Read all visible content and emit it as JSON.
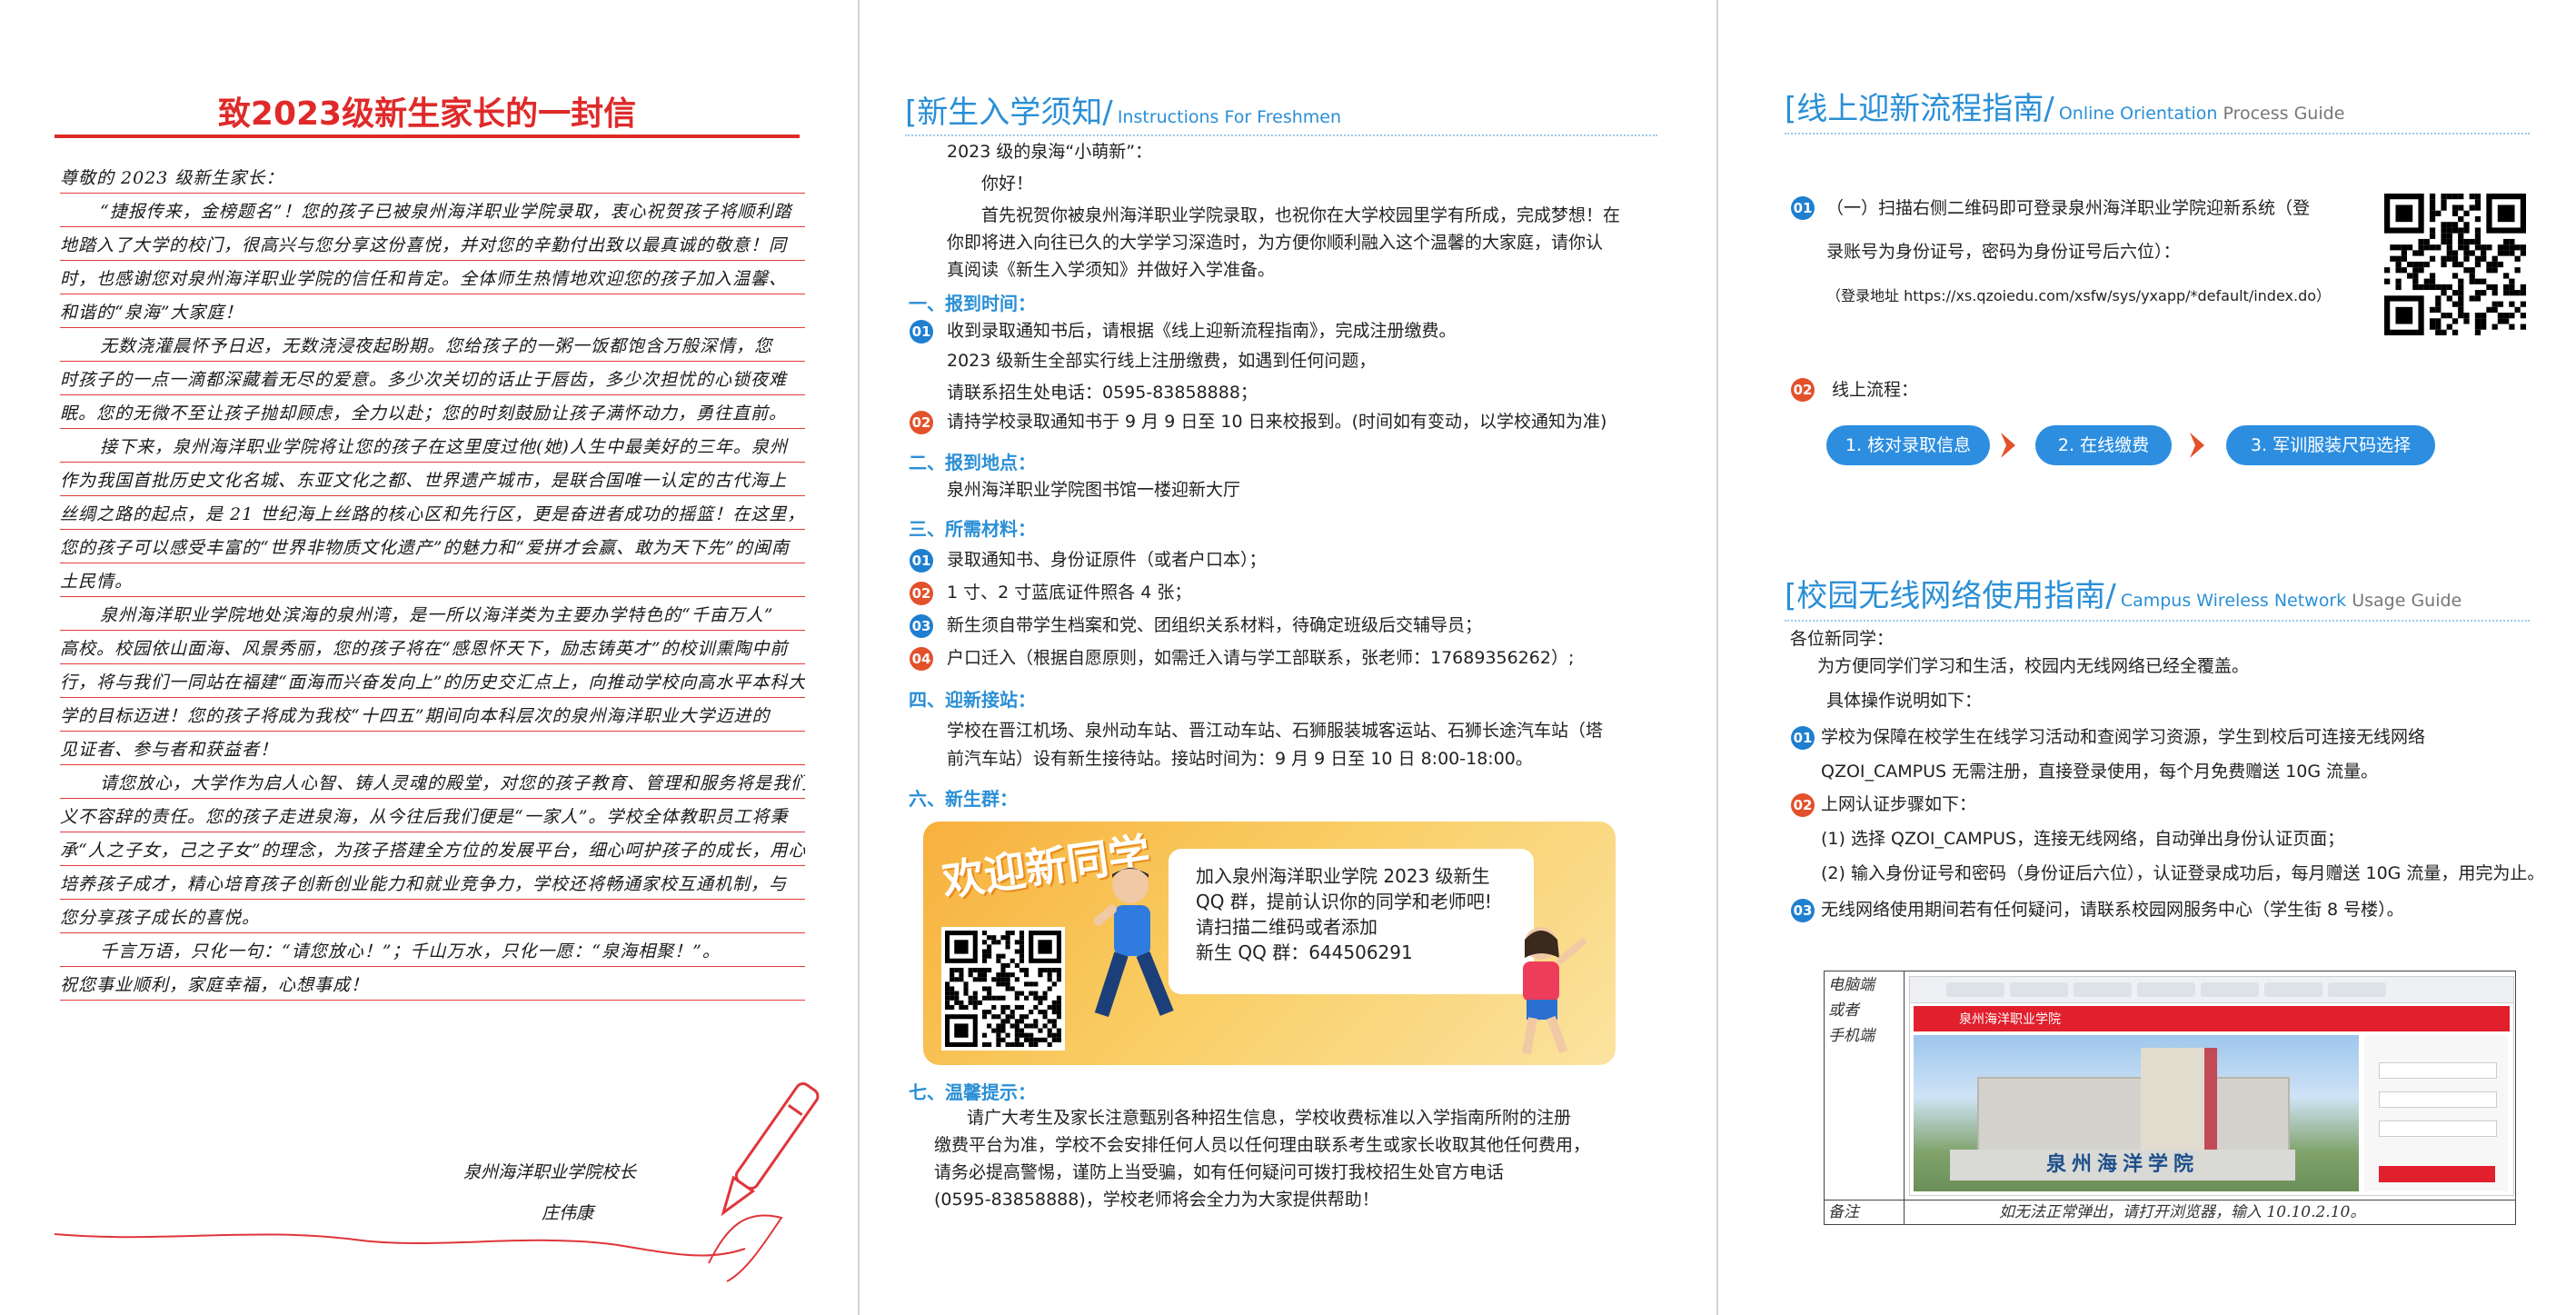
{
  "letter": {
    "title": "致2023级新生家长的一封信",
    "lines": [
      {
        "t": "尊敬的 2023 级新生家长：",
        "indent": false
      },
      {
        "t": "“捷报传来，金榜题名”！您的孩子已被泉州海洋职业学院录取，衷心祝贺孩子将顺利踏",
        "indent": true
      },
      {
        "t": "地踏入了大学的校门，很高兴与您分享这份喜悦，并对您的辛勤付出致以最真诚的敬意！同",
        "indent": false
      },
      {
        "t": "时，也感谢您对泉州海洋职业学院的信任和肯定。全体师生热情地欢迎您的孩子加入温馨、",
        "indent": false
      },
      {
        "t": "和谐的“泉海”大家庭！",
        "indent": false
      },
      {
        "t": "无数浇灌晨怀予日迟，无数浇浸夜起盼期。您给孩子的一粥一饭都饱含万般深情，您",
        "indent": true
      },
      {
        "t": "时孩子的一点一滴都深藏着无尽的爱意。多少次关切的话止于唇齿，多少次担忧的心锁夜难",
        "indent": false
      },
      {
        "t": "眠。您的无微不至让孩子抛却顾虑，全力以赴；您的时刻鼓励让孩子满怀动力，勇往直前。",
        "indent": false
      },
      {
        "t": "接下来，泉州海洋职业学院将让您的孩子在这里度过他(她)人生中最美好的三年。泉州",
        "indent": true
      },
      {
        "t": "作为我国首批历史文化名城、东亚文化之都、世界遗产城市，是联合国唯一认定的古代海上",
        "indent": false
      },
      {
        "t": "丝绸之路的起点，是 21 世纪海上丝路的核心区和先行区，更是奋进者成功的摇篮！在这里，",
        "indent": false
      },
      {
        "t": "您的孩子可以感受丰富的“世界非物质文化遗产”的魅力和“爱拼才会赢、敢为天下先”的闽南",
        "indent": false
      },
      {
        "t": "土民情。",
        "indent": false
      },
      {
        "t": "泉州海洋职业学院地处滨海的泉州湾，是一所以海洋类为主要办学特色的“千亩万人”",
        "indent": true
      },
      {
        "t": "高校。校园依山面海、风景秀丽，您的孩子将在“感恩怀天下，励志铸英才”的校训熏陶中前",
        "indent": false
      },
      {
        "t": "行，将与我们一同站在福建“面海而兴奋发向上”的历史交汇点上，向推动学校向高水平本科大",
        "indent": false
      },
      {
        "t": "学的目标迈进！您的孩子将成为我校“十四五”期间向本科层次的泉州海洋职业大学迈进的",
        "indent": false
      },
      {
        "t": "见证者、参与者和获益者！",
        "indent": false
      },
      {
        "t": "请您放心，大学作为启人心智、铸人灵魂的殿堂，对您的孩子教育、管理和服务将是我们",
        "indent": true
      },
      {
        "t": "义不容辞的责任。您的孩子走进泉海，从今往后我们便是“一家人”。学校全体教职员工将秉",
        "indent": false
      },
      {
        "t": "承“人之子女，己之子女”的理念，为孩子搭建全方位的发展平台，细心呵护孩子的成长，用心",
        "indent": false
      },
      {
        "t": "培养孩子成才，精心培育孩子创新创业能力和就业竞争力，学校还将畅通家校互通机制，与",
        "indent": false
      },
      {
        "t": "您分享孩子成长的喜悦。",
        "indent": false
      },
      {
        "t": "千言万语，只化一句：“请您放心！”；千山万水，只化一愿：“泉海相聚！”。",
        "indent": true
      },
      {
        "t": "祝您事业顺利，家庭幸福，心想事成！",
        "indent": false
      }
    ],
    "signature_school": "泉州海洋职业学院校长",
    "signature_name": "庄伟康"
  },
  "instructions": {
    "title_zh": "[新生入学须知/",
    "title_en": "Instructions For Freshmen",
    "greeting": "2023 级的泉海“小萌新”：",
    "hello": "你好！",
    "intro1": "首先祝贺你被泉州海洋职业学院录取，也祝你在大学校园里学有所成，完成梦想！在",
    "intro2": "你即将进入向往已久的大学学习深造时，为方便你顺利融入这个温馨的大家庭，请你认",
    "intro3": "真阅读《新生入学须知》并做好入学准备。",
    "s1_title": "一、报到时间：",
    "s1_i1": "收到录取通知书后，请根据《线上迎新流程指南》，完成注册缴费。",
    "s1_i1b": "2023 级新生全部实行线上注册缴费，如遇到任何问题，",
    "s1_i1c": "请联系招生处电话：0595-83858888；",
    "s1_i2": "请持学校录取通知书于 9 月 9 日至 10 日来校报到。(时间如有变动，以学校通知为准)",
    "s2_title": "二、报到地点：",
    "s2_text": "泉州海洋职业学院图书馆一楼迎新大厅",
    "s3_title": "三、所需材料：",
    "s3_i1": "录取通知书、身份证原件（或者户口本）；",
    "s3_i2": "1 寸、2 寸蓝底证件照各 4 张；",
    "s3_i3": "新生须自带学生档案和党、团组织关系材料，待确定班级后交辅导员；",
    "s3_i4": "户口迁入（根据自愿原则，如需迁入请与学工部联系，张老师：17689356262）;",
    "s4_title": "四、迎新接站：",
    "s4_t1": "学校在晋江机场、泉州动车站、晋江动车站、石狮服装城客运站、石狮长途汽车站（塔",
    "s4_t2": "前汽车站）设有新生接待站。接站时间为：9 月 9 日至 10 日 8:00-18:00。",
    "s5_title": "六、新生群：",
    "card_title": "欢迎新同学",
    "card_l1": "加入泉州海洋职业学院 2023 级新生",
    "card_l2": "QQ 群，提前认识你的同学和老师吧!",
    "card_l3": "请扫描二维码或者添加",
    "card_l4": "新生 QQ 群：644506291",
    "s7_title": "七、温馨提示：",
    "s7_t1": "请广大考生及家长注意甄别各种招生信息，学校收费标准以入学指南所附的注册",
    "s7_t2": "缴费平台为准，学校不会安排任何人员以任何理由联系考生或家长收取其他任何费用，",
    "s7_t3": "请务必提高警惕，谨防上当受骗，如有任何疑问可拨打我校招生处官方电话",
    "s7_t4": "(0595-83858888)，学校老师将会全力为大家提供帮助！",
    "nums": [
      "01",
      "02",
      "03",
      "04"
    ]
  },
  "online": {
    "title_zh": "[线上迎新流程指南/",
    "title_en_a": "Online Orientation",
    "title_en_b": "Process Guide",
    "step1_a": "（一）扫描右侧二维码即可登录泉州海洋职业学院迎新系统（登",
    "step1_b": "录账号为身份证号，密码为身份证号后六位）：",
    "step1_url": "（登录地址 https://xs.qzoiedu.com/xsfw/sys/yxapp/*default/index.do）",
    "step2": "线上流程：",
    "flow": [
      "1. 核对录取信息",
      "2. 在线缴费",
      "3. 军训服装尺码选择"
    ]
  },
  "wifi": {
    "title_zh": "[校园无线网络使用指南/",
    "title_en_a": "Campus Wireless Network",
    "title_en_b": "Usage Guide",
    "greet": "各位新同学：",
    "l1": "为方便同学们学习和生活，校园内无线网络已经全覆盖。",
    "l2": "具体操作说明如下：",
    "i1a": "学校为保障在校学生在线学习活动和查阅学习资源，学生到校后可连接无线网络",
    "i1b": "QZOI_CAMPUS 无需注册，直接登录使用，每个月免费赠送 10G 流量。",
    "i2": "上网认证步骤如下：",
    "i2a": "(1) 选择 QZOI_CAMPUS，连接无线网络，自动弹出身份认证页面；",
    "i2b": "(2) 输入身份证号和密码（身份证后六位），认证登录成功后，每月赠送 10G 流量，用完为止。",
    "i3": "无线网络使用期间若有任何疑问，请联系校园网服务中心（学生街 8 号楼）。",
    "shot_left": "电脑端\n或者\n手机端",
    "shot_note_label": "备注",
    "shot_note": "如无法正常弹出，请打开浏览器，输入 10.10.2.10。",
    "browser_header": "泉州海洋职业学院",
    "browser_sign": "泉州海洋学院"
  }
}
